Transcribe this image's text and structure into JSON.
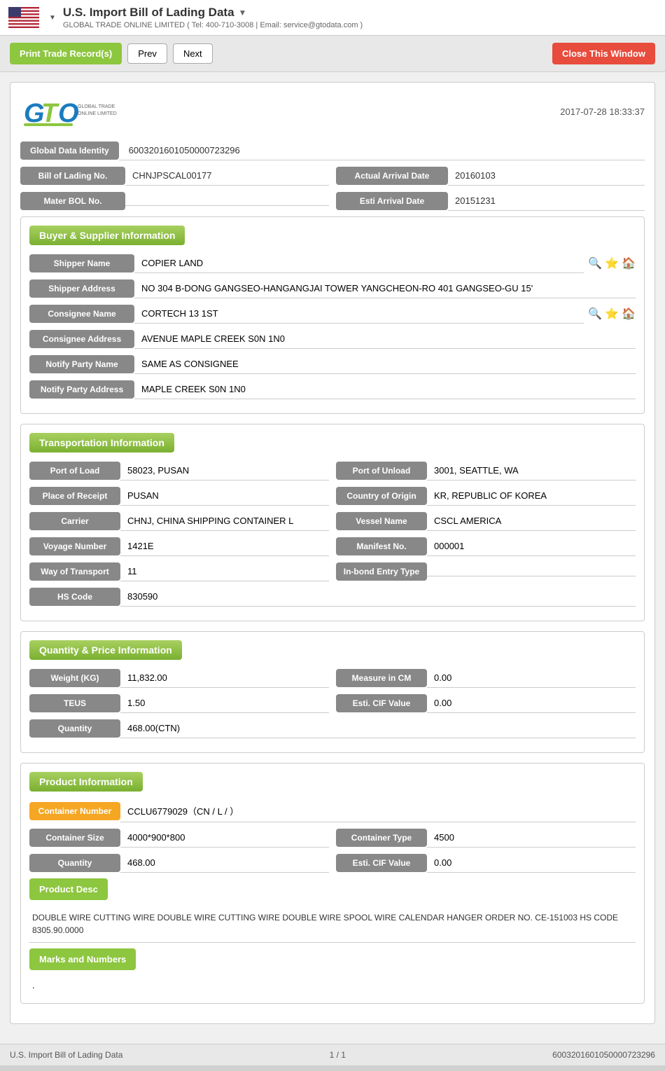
{
  "topbar": {
    "title": "U.S. Import Bill of Lading Data",
    "subtitle": "GLOBAL TRADE ONLINE LIMITED ( Tel: 400-710-3008 | Email: service@gtodata.com )",
    "dropdown_arrow": "▼"
  },
  "toolbar": {
    "print_label": "Print Trade Record(s)",
    "prev_label": "Prev",
    "next_label": "Next",
    "close_label": "Close This Window"
  },
  "logo": {
    "timestamp": "2017-07-28 18:33:37",
    "company_name": "GLOBAL TRADE ONLINE LIMITED"
  },
  "header_fields": {
    "global_data_identity_label": "Global Data Identity",
    "global_data_identity_value": "6003201601050000723296",
    "bill_of_lading_label": "Bill of Lading No.",
    "bill_of_lading_value": "CHNJPSCAL00177",
    "actual_arrival_label": "Actual Arrival Date",
    "actual_arrival_value": "20160103",
    "master_bol_label": "Mater BOL No.",
    "master_bol_value": "",
    "esti_arrival_label": "Esti Arrival Date",
    "esti_arrival_value": "20151231"
  },
  "buyer_supplier": {
    "section_title": "Buyer & Supplier Information",
    "shipper_name_label": "Shipper Name",
    "shipper_name_value": "COPIER LAND",
    "shipper_address_label": "Shipper Address",
    "shipper_address_value": "NO 304 B-DONG GANGSEO-HANGANGJAI TOWER YANGCHEON-RO 401 GANGSEO-GU 15'",
    "consignee_name_label": "Consignee Name",
    "consignee_name_value": "CORTECH 13 1ST",
    "consignee_address_label": "Consignee Address",
    "consignee_address_value": "AVENUE MAPLE CREEK S0N 1N0",
    "notify_party_name_label": "Notify Party Name",
    "notify_party_name_value": "SAME AS CONSIGNEE",
    "notify_party_address_label": "Notify Party Address",
    "notify_party_address_value": "MAPLE CREEK S0N 1N0"
  },
  "transportation": {
    "section_title": "Transportation Information",
    "port_of_load_label": "Port of Load",
    "port_of_load_value": "58023, PUSAN",
    "port_of_unload_label": "Port of Unload",
    "port_of_unload_value": "3001, SEATTLE, WA",
    "place_of_receipt_label": "Place of Receipt",
    "place_of_receipt_value": "PUSAN",
    "country_of_origin_label": "Country of Origin",
    "country_of_origin_value": "KR, REPUBLIC OF KOREA",
    "carrier_label": "Carrier",
    "carrier_value": "CHNJ, CHINA SHIPPING CONTAINER L",
    "vessel_name_label": "Vessel Name",
    "vessel_name_value": "CSCL AMERICA",
    "voyage_number_label": "Voyage Number",
    "voyage_number_value": "1421E",
    "manifest_no_label": "Manifest No.",
    "manifest_no_value": "000001",
    "way_of_transport_label": "Way of Transport",
    "way_of_transport_value": "11",
    "inbond_entry_label": "In-bond Entry Type",
    "inbond_entry_value": "",
    "hs_code_label": "HS Code",
    "hs_code_value": "830590"
  },
  "quantity_price": {
    "section_title": "Quantity & Price Information",
    "weight_kg_label": "Weight (KG)",
    "weight_kg_value": "11,832.00",
    "measure_cm_label": "Measure in CM",
    "measure_cm_value": "0.00",
    "teus_label": "TEUS",
    "teus_value": "1.50",
    "esti_cif_label": "Esti. CIF Value",
    "esti_cif_value": "0.00",
    "quantity_label": "Quantity",
    "quantity_value": "468.00(CTN)"
  },
  "product": {
    "section_title": "Product Information",
    "container_number_label": "Container Number",
    "container_number_value": "CCLU6779029（CN / L / ）",
    "container_size_label": "Container Size",
    "container_size_value": "4000*900*800",
    "container_type_label": "Container Type",
    "container_type_value": "4500",
    "quantity_label": "Quantity",
    "quantity_value": "468.00",
    "esti_cif_label": "Esti. CIF Value",
    "esti_cif_value": "0.00",
    "product_desc_label": "Product Desc",
    "product_desc_text": "DOUBLE WIRE CUTTING WIRE DOUBLE WIRE CUTTING WIRE DOUBLE WIRE SPOOL WIRE CALENDAR HANGER ORDER NO. CE-151003 HS CODE 8305.90.0000",
    "marks_numbers_label": "Marks and Numbers",
    "marks_numbers_value": "."
  },
  "footer": {
    "left_text": "U.S. Import Bill of Lading Data",
    "page_text": "1 / 1",
    "right_text": "6003201601050000723296"
  }
}
